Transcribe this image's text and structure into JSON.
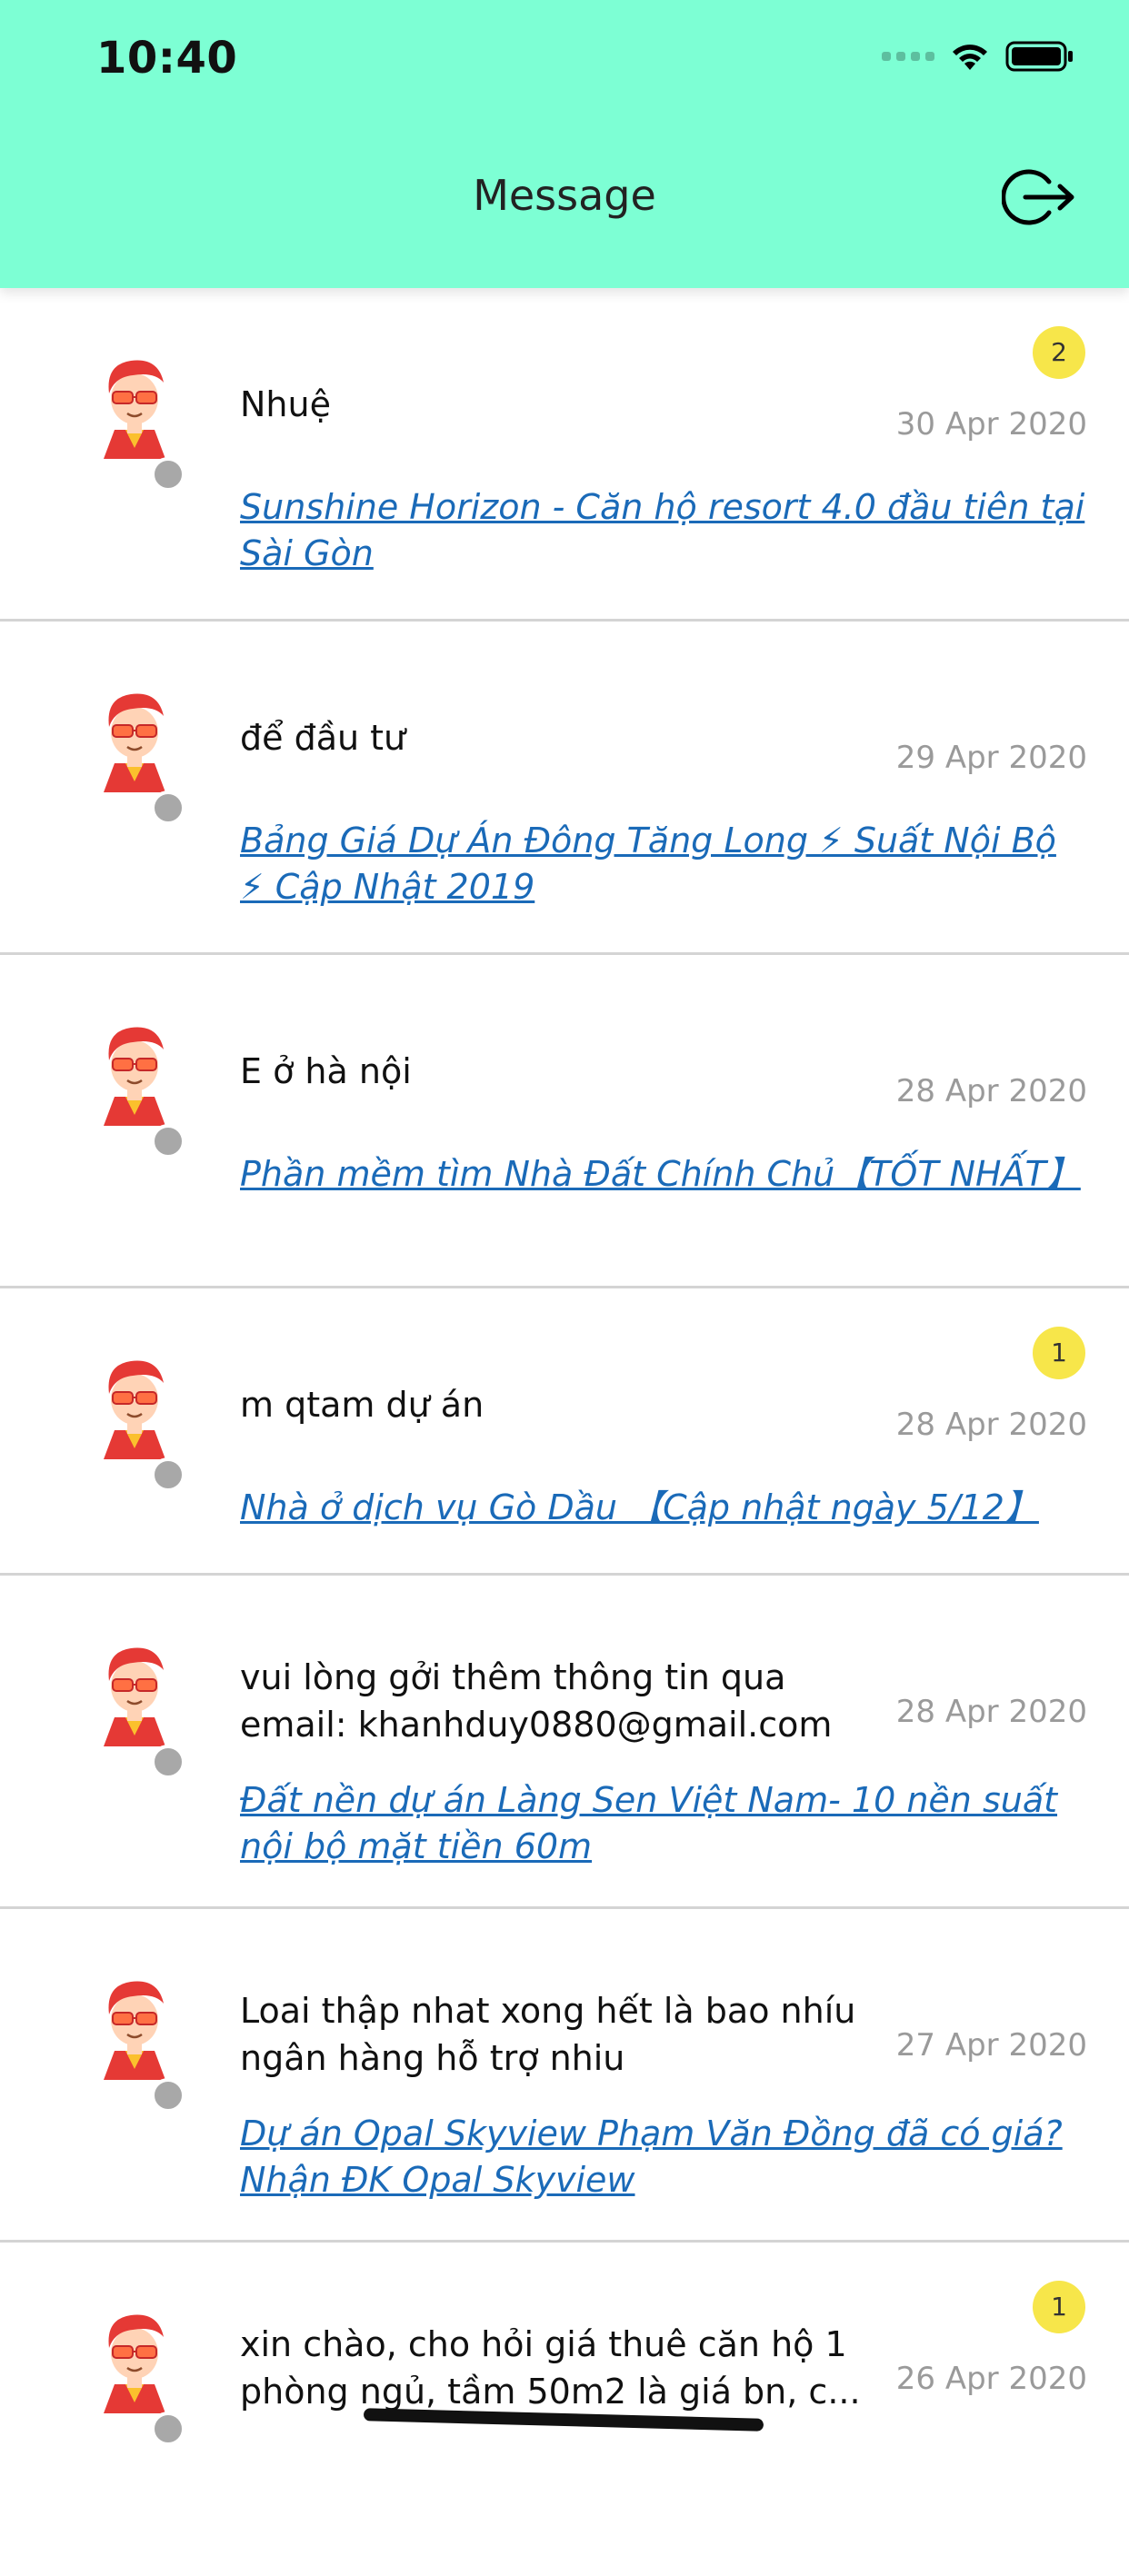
{
  "status_bar": {
    "time": "10:40"
  },
  "header": {
    "title": "Message",
    "logout_icon": "logout-icon"
  },
  "colors": {
    "header_bg": "#7dffd4",
    "link": "#1a6ab8",
    "badge": "#f7e64a",
    "date": "#9a9a9a",
    "presence": "#a8a8a8"
  },
  "conversations": [
    {
      "sender": "Nhuệ",
      "date": "30 Apr 2020",
      "badge": "2",
      "link": "Sunshine Horizon - Căn hộ resort 4.0 đầu tiên tại Sài Gòn"
    },
    {
      "sender": "để đầu tư",
      "date": "29 Apr 2020",
      "badge": "",
      "link": "Bảng Giá Dự Án Đông Tăng Long ⚡ Suất Nội Bộ ⚡ Cập Nhật 2019"
    },
    {
      "sender": "E ở hà nội",
      "date": "28 Apr 2020",
      "badge": "",
      "link": "Phần mềm tìm Nhà Đất Chính Chủ【TỐT NHẤT】"
    },
    {
      "sender": "m qtam dự án",
      "date": "28 Apr 2020",
      "badge": "1",
      "link": "Nhà ở dịch vụ Gò Dầu 【Cập nhật ngày 5/12】"
    },
    {
      "sender": "vui lòng gởi thêm thông tin qua email: khanhduy0880@gmail.com",
      "date": "28 Apr 2020",
      "badge": "",
      "link": "Đất nền dự án Làng Sen Việt Nam- 10 nền suất nội bộ mặt tiền 60m"
    },
    {
      "sender": "Loai thập nhat xong hết là bao nhíu ngân hàng hỗ trợ nhiu",
      "date": "27 Apr 2020",
      "badge": "",
      "link": "Dự án Opal Skyview Phạm Văn Đồng đã có giá? Nhận ĐK Opal Skyview"
    },
    {
      "sender": "xin chào, cho hỏi giá thuê căn hộ 1 phòng ngủ, tầm 50m2 là giá bn, c...",
      "date": "26 Apr 2020",
      "badge": "1",
      "link": ""
    }
  ]
}
